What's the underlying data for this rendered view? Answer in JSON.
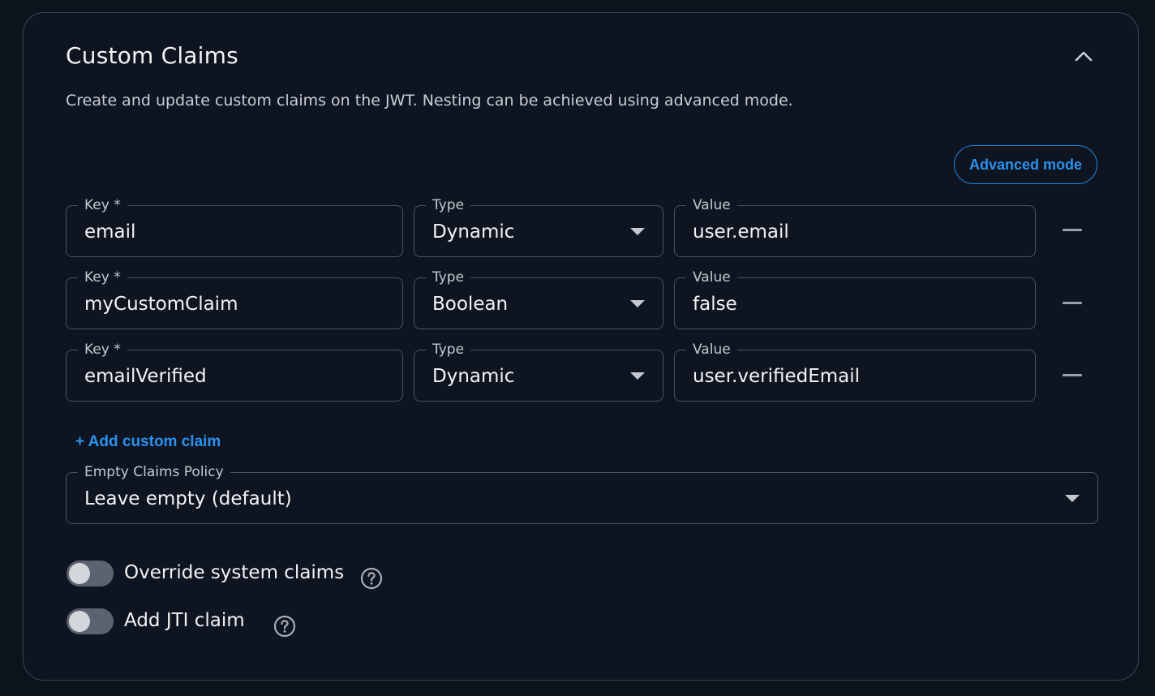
{
  "section": {
    "title": "Custom Claims",
    "description": "Create and update custom claims on the JWT. Nesting can be achieved using advanced mode.",
    "advanced_mode_label": "Advanced mode",
    "collapse_icon": "chevron-up-icon"
  },
  "claims": [
    {
      "key_label": "Key *",
      "key": "email",
      "type_label": "Type",
      "type": "Dynamic",
      "value_label": "Value",
      "value": "user.email"
    },
    {
      "key_label": "Key *",
      "key": "myCustomClaim",
      "type_label": "Type",
      "type": "Boolean",
      "value_label": "Value",
      "value": "false"
    },
    {
      "key_label": "Key *",
      "key": "emailVerified",
      "type_label": "Type",
      "type": "Dynamic",
      "value_label": "Value",
      "value": "user.verifiedEmail"
    }
  ],
  "add_claim_label": "+ Add custom claim",
  "empty_policy": {
    "label": "Empty Claims Policy",
    "value": "Leave empty (default)"
  },
  "toggles": [
    {
      "label": "Override system claims",
      "enabled": false
    },
    {
      "label": "Add JTI claim",
      "enabled": false
    }
  ],
  "colors": {
    "accent": "#2b91f0",
    "background": "#0d131d",
    "border": "#4a525d"
  }
}
